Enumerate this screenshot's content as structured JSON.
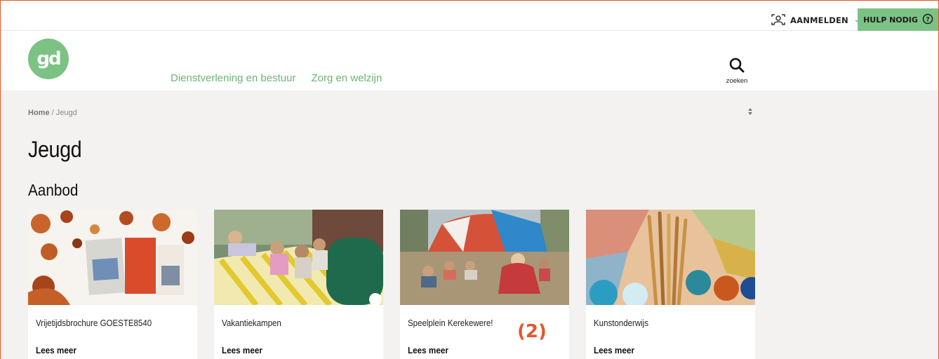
{
  "topbar": {
    "login_label": "AANMELDEN",
    "help_label": "HULP NODIG",
    "help_color": "#7cc285"
  },
  "header": {
    "logo_text": "gd",
    "nav": [
      "Dienstverlening en bestuur",
      "Zorg en welzijn"
    ],
    "search_label": "zoeken",
    "accent": "#6bb574"
  },
  "breadcrumb": {
    "home": "Home",
    "separator": "/",
    "current": "Jeugd"
  },
  "page": {
    "title": "Jeugd",
    "section": "Aanbod"
  },
  "cards": [
    {
      "title": "Vrijetijdsbrochure GOESTE8540",
      "link": "Lees meer"
    },
    {
      "title": "Vakantiekampen",
      "link": "Lees meer"
    },
    {
      "title": "Speelplein Kerekewere!",
      "link": "Lees meer"
    },
    {
      "title": "Kunstonderwijs",
      "link": "Lees meer"
    }
  ],
  "annotation": {
    "badge": "(2)",
    "color": "#e4572e"
  },
  "icons": [
    "user-id-icon",
    "chevron-down-icon",
    "help-circle-icon",
    "search-icon",
    "sort-icon"
  ]
}
